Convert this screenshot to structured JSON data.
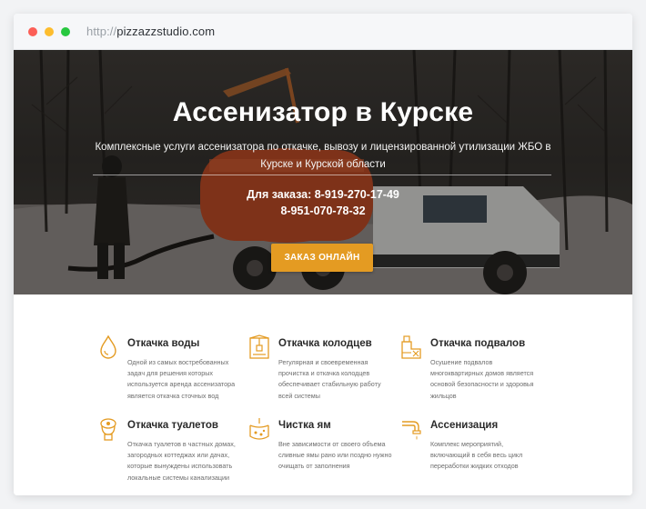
{
  "browser": {
    "url_protocol": "http://",
    "url_domain": "pizzazzstudio.com"
  },
  "hero": {
    "title": "Ассенизатор в Курске",
    "subtitle": "Комплексные услуги ассенизатора по откачке, вывозу и лицензированной утилизации ЖБО в Курске и Курской области",
    "phone_line_1": "Для заказа: 8-919-270-17-49",
    "phone_line_2": "8-951-070-78-32",
    "order_button": "ЗАКАЗ ОНЛАЙН"
  },
  "colors": {
    "accent": "#e49b22",
    "tank": "#b8441f"
  },
  "services": [
    {
      "icon": "water-drop-icon",
      "title": "Откачка воды",
      "text": "Одной из самых востребованных задач для решения которых используется аренда ассенизатора является откачка сточных вод"
    },
    {
      "icon": "well-icon",
      "title": "Откачка колодцев",
      "text": "Регулярная и своевременная прочистка и откачка колодцев обеспечивает стабильную работу всей системы"
    },
    {
      "icon": "basement-icon",
      "title": "Откачка подвалов",
      "text": "Осушение подвалов многоквартирных домов является основой безопасности и здоровья жильцов"
    },
    {
      "icon": "toilet-icon",
      "title": "Откачка туалетов",
      "text": "Откачка туалетов в частных домах, загородных коттеджах или дачах, которые вынуждены использовать локальные системы канализации"
    },
    {
      "icon": "pit-icon",
      "title": "Чистка ям",
      "text": "Вне зависимости от своего объема сливные ямы рано или поздно нужно очищать от заполнения"
    },
    {
      "icon": "pipe-icon",
      "title": "Ассенизация",
      "text": "Комплекс мероприятий, включающий в себя весь цикл переработки жидких отходов"
    }
  ]
}
